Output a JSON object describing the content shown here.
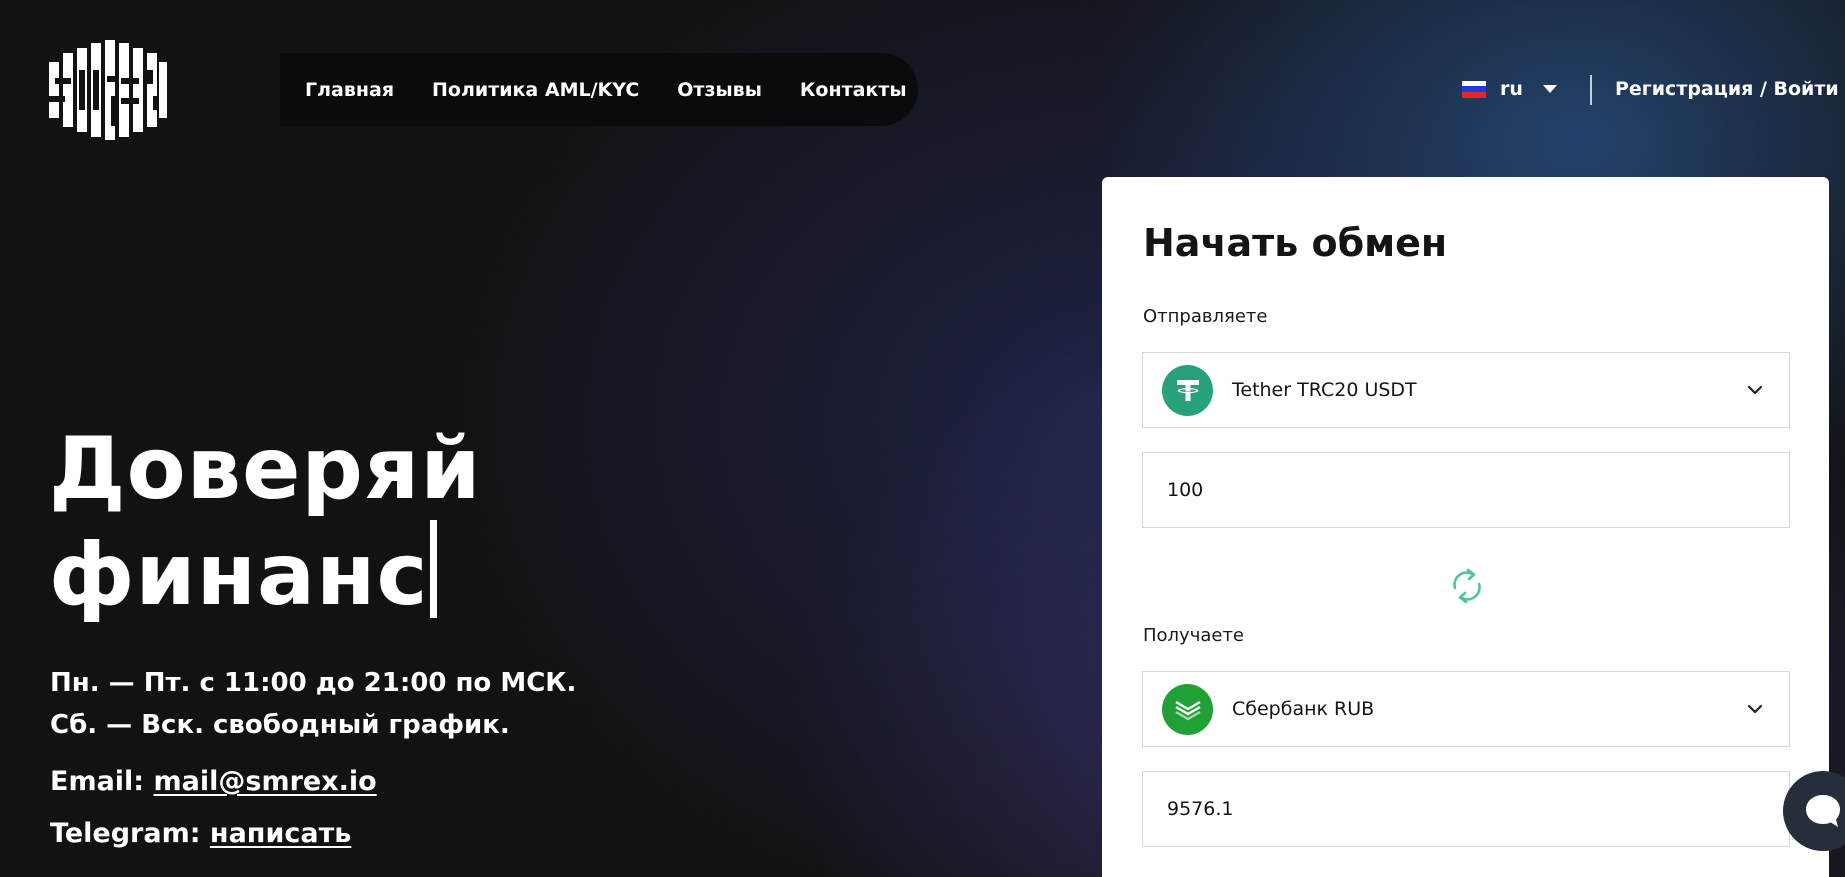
{
  "header": {
    "logo_text": "SMREX",
    "nav": [
      {
        "label": "Главная"
      },
      {
        "label": "Политика AML/KYC"
      },
      {
        "label": "Отзывы"
      },
      {
        "label": "Контакты"
      }
    ],
    "language": {
      "label": "ru",
      "flag_colors": [
        "#ffffff",
        "#1c3fd8",
        "#e4252c"
      ]
    },
    "auth_label": "Регистрация / Войти"
  },
  "hero": {
    "title_line1": "Доверяй",
    "title_line2": "финанс",
    "hours_line1": "Пн. — Пт. с 11:00 до 21:00 по МСК.",
    "hours_line2": "Сб. — Вск. свободный график.",
    "email_label": "Email:",
    "email_value": "mail@smrex.io",
    "telegram_label": "Telegram:",
    "telegram_value": "написать"
  },
  "exchange": {
    "title": "Начать обмен",
    "send_label": "Отправляете",
    "send_currency": {
      "name": "Tether TRC20 USDT",
      "icon": "tether-icon",
      "color": "#26a17b"
    },
    "send_amount": "100",
    "swap_icon": "refresh-icon",
    "receive_label": "Получаете",
    "receive_currency": {
      "name": "Сбербанк RUB",
      "icon": "sberbank-icon",
      "color": "#21a038"
    },
    "receive_amount": "9576.1"
  },
  "chat": {
    "icon": "chat-icon"
  },
  "colors": {
    "accent": "#26a17b",
    "swap_icon": "#4fc59a",
    "background": "#121214"
  }
}
